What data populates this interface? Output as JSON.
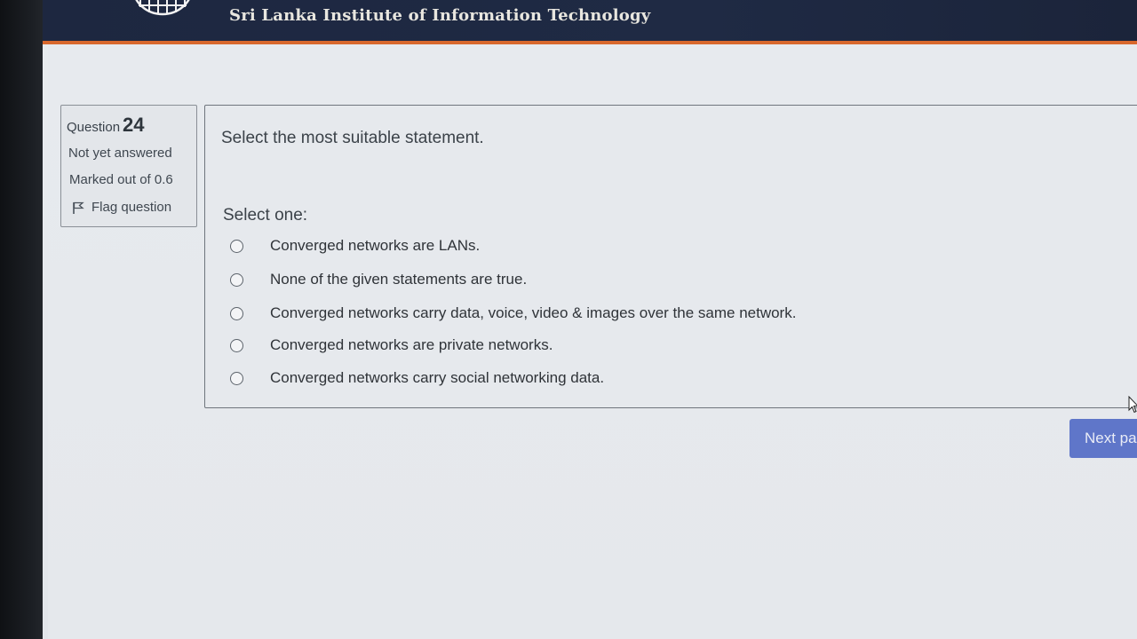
{
  "header": {
    "site_title": "Sri Lanka Institute of Information Technology",
    "logo_icon": "globe-logo-icon",
    "bg_color": "#1f2a44",
    "accent_stripe_color": "#d8682d"
  },
  "question_info": {
    "question_word": "Question",
    "question_number": "24",
    "state": "Not yet answered",
    "marks": "Marked out of 0.6",
    "flag_label": "Flag question",
    "flag_icon": "flag-icon"
  },
  "question": {
    "text": "Select the most suitable statement.",
    "prompt": "Select one:",
    "options": [
      {
        "label": "Converged networks are LANs."
      },
      {
        "label": "None of the given statements are true."
      },
      {
        "label": "Converged networks carry data, voice, video & images over the same network."
      },
      {
        "label": "Converged networks are private networks."
      },
      {
        "label": "Converged networks carry social networking data."
      }
    ]
  },
  "navigation": {
    "next_label": "Next pa",
    "button_color": "#5f76c9"
  }
}
